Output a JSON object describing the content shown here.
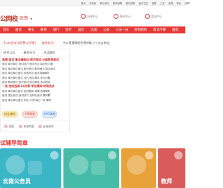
{
  "topbar": {
    "links": [
      "首页",
      "手机版",
      "事业单位",
      "教师招聘",
      "银行招聘",
      "医疗卫生",
      "招警",
      "三支",
      "选调",
      "事业",
      "招聘"
    ]
  },
  "header": {
    "logo": "公网校",
    "city": "云南",
    "buttons": [
      {
        "label": "听课中心",
        "icon": "circle-icon"
      },
      {
        "label": "移动中心",
        "icon": "circle-icon"
      },
      {
        "label": "登录中心",
        "icon": "circle-icon"
      }
    ]
  },
  "nav": {
    "items": [
      "首页",
      "面试",
      "事业",
      "教师",
      "银行",
      "医疗",
      "国企",
      "选调",
      "公安",
      "三支一扶",
      "特岗教师",
      "政法干警",
      "遴选"
    ]
  },
  "notice": {
    "t1": "【公务员考试免费公开课】",
    "t2": "备考技巧：",
    "t3": "中公直播课程免费领取 >>点击参加"
  },
  "panel": {
    "tabs": [
      "招考公告",
      "备考技巧",
      "考试题库"
    ],
    "lines": [
      {
        "text": "直播 面试 事业编面试 医疗面试 云南特岗面试",
        "hot": true
      },
      {
        "text": "面试 事业单位 面试技巧 面试热点 每日练习题",
        "hot": false
      },
      {
        "text": "面试 事业单位面试 医疗面试 教师面试 国企面试",
        "hot": false
      },
      {
        "text": "面试 事业单位面试 时政热点 面试真题解析",
        "hot": false
      },
      {
        "text": "面试 事业单位面试 技巧 面试指导 常见问题",
        "hot": false
      },
      {
        "text": "面试 教师面试 医疗面试 面试题库 考点精讲",
        "hot": false
      },
      {
        "text": "一扶 定向选调 24文职 申论模拟 时政热点",
        "hot": true
      },
      {
        "text": "面试 事业单位面试 面试题库 真题 答案解析",
        "hot": false
      },
      {
        "text": "面试 国企面试 面试技巧 结构化面试 模拟题",
        "hot": false
      },
      {
        "text": "面试 事业单位面试 申论 行测 每日一练 模考",
        "hot": false
      }
    ],
    "pills": [
      "协会课程",
      "VIP课程",
      "OAO课程"
    ],
    "bottom": [
      {
        "label": "搜索",
        "icon": "search-icon"
      },
      {
        "label": "申请专题",
        "icon": "bookmark-icon"
      },
      {
        "label": "咨询老师",
        "icon": "chat-icon"
      }
    ]
  },
  "section": {
    "title": "试辅导简章"
  },
  "cards": [
    {
      "label": "云南公务员",
      "color": "#3bb6c7"
    },
    {
      "label": "",
      "color": "#44bca7"
    },
    {
      "label": "",
      "color": "#e8a23a"
    },
    {
      "label": "教师",
      "color": "#d95b5b"
    }
  ]
}
